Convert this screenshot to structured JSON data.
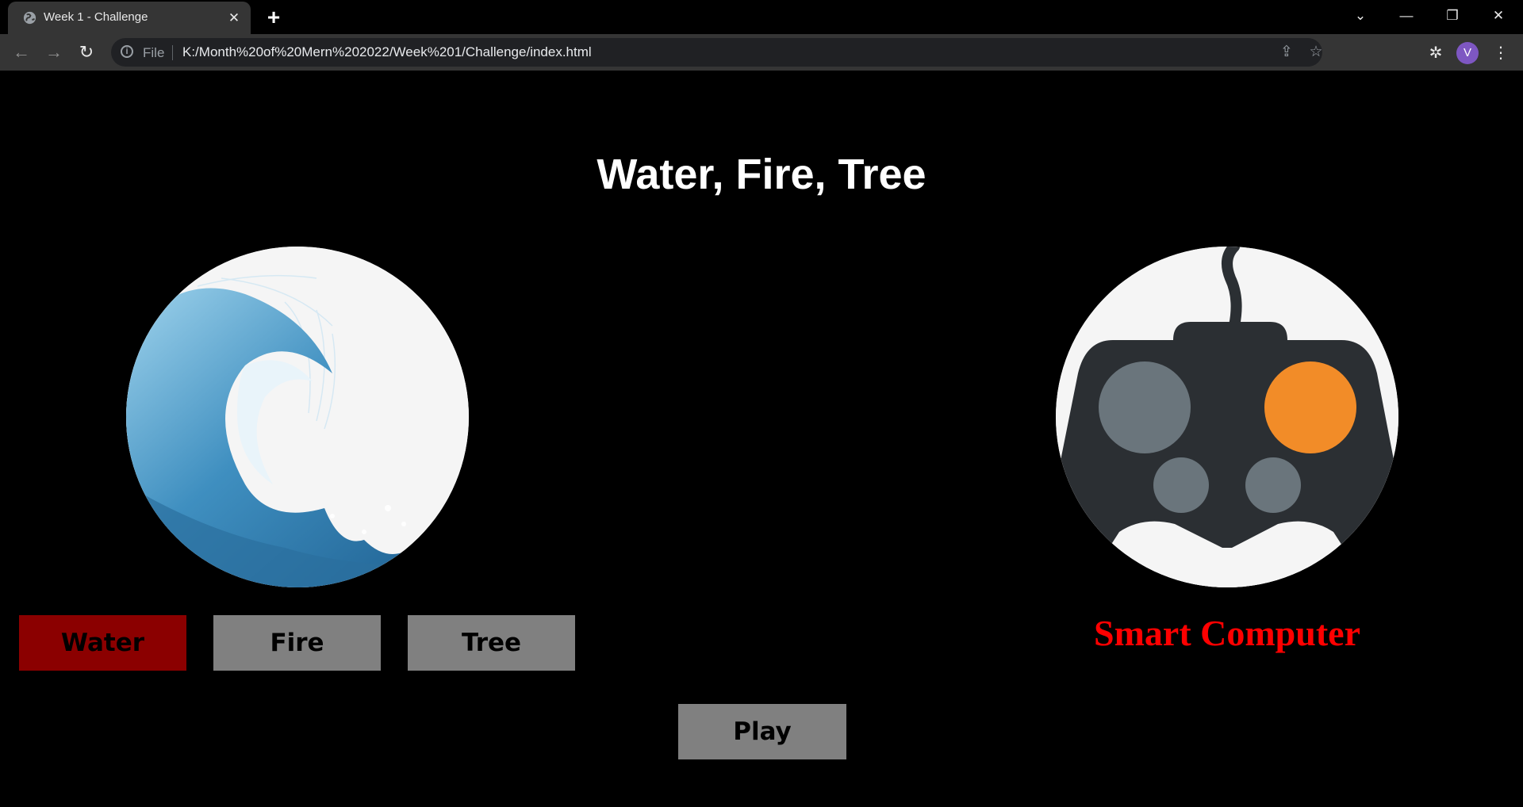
{
  "browser": {
    "tab_title": "Week 1 - Challenge",
    "scheme_label": "File",
    "url": "K:/Month%20of%20Mern%202022/Week%201/Challenge/index.html",
    "avatar_letter": "V"
  },
  "game": {
    "title": "Water, Fire, Tree",
    "player_image": "water-wave-image",
    "computer_image": "gamepad-image",
    "choices": [
      "Water",
      "Fire",
      "Tree"
    ],
    "selected_choice": "Water",
    "computer_label": "Smart Computer",
    "play_label": "Play"
  },
  "colors": {
    "selected_choice": "#8b0000",
    "button_default": "#808080",
    "computer_label": "#ff0000",
    "gamepad_body": "#2b2f33",
    "gamepad_button_grey": "#6a757c",
    "gamepad_button_orange": "#f28c28"
  }
}
